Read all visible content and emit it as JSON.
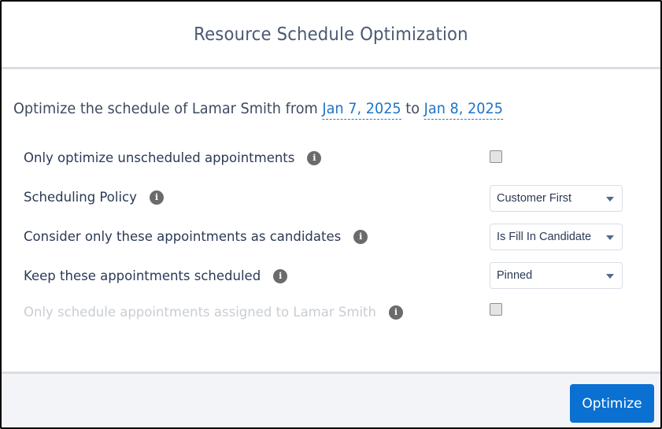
{
  "dialog": {
    "title": "Resource Schedule Optimization"
  },
  "summary": {
    "prefix": "Optimize the schedule of",
    "resource_name": "Lamar Smith",
    "from_word": "from",
    "start_date": "Jan 7, 2025",
    "to_word": "to",
    "end_date": "Jan 8, 2025"
  },
  "options": [
    {
      "label": "Only optimize unscheduled appointments",
      "control": "checkbox",
      "checked": false,
      "disabled": false,
      "icon": "info-icon"
    },
    {
      "label": "Scheduling Policy",
      "control": "select",
      "value": "Customer First",
      "icon": "info-icon"
    },
    {
      "label": "Consider only these appointments as candidates",
      "control": "select",
      "value": "Is Fill In Candidate",
      "icon": "info-icon"
    },
    {
      "label": "Keep these appointments scheduled",
      "control": "select",
      "value": "Pinned",
      "icon": "info-icon"
    },
    {
      "label": "Only schedule appointments assigned to Lamar Smith",
      "control": "checkbox",
      "checked": false,
      "disabled": true,
      "icon": "info-icon"
    }
  ],
  "info_glyph": "i",
  "footer": {
    "optimize_label": "Optimize"
  },
  "colors": {
    "accent": "#0a70d2",
    "link": "#1f74c7",
    "disabled_text": "#c9cdd3"
  }
}
